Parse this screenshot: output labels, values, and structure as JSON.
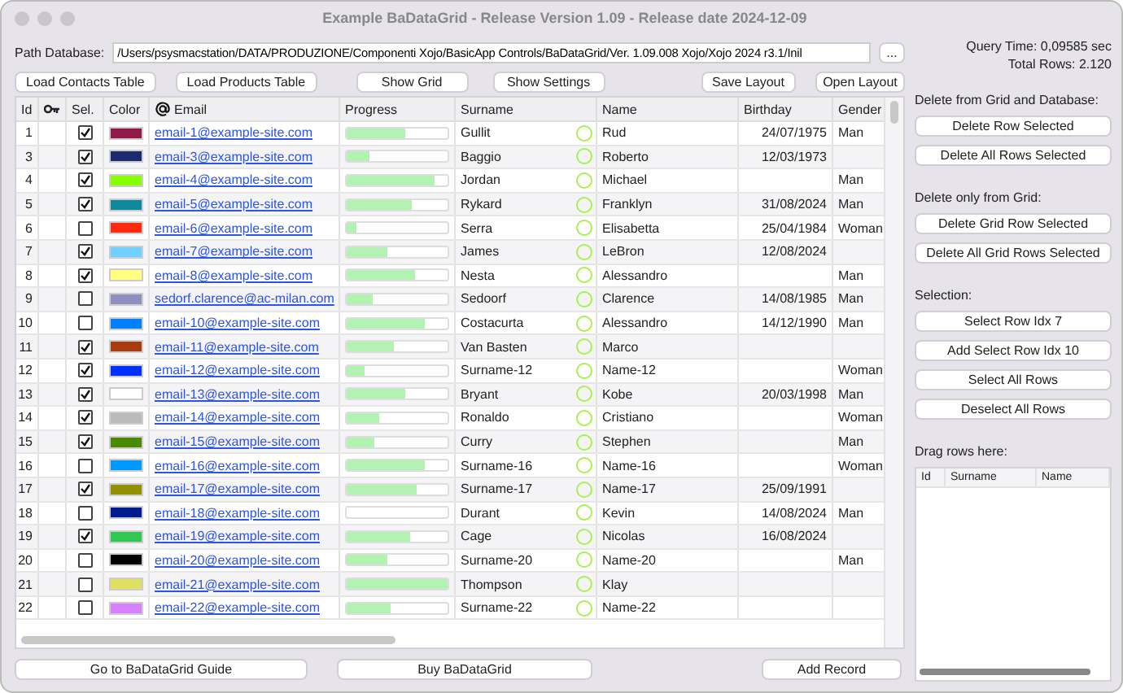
{
  "window": {
    "title": "Example BaDataGrid - Release Version 1.09 - Release date 2024-12-09"
  },
  "path": {
    "label": "Path Database:",
    "value": "/Users/psysmacstation/DATA/PRODUZIONE/Componenti Xojo/BasicApp Controls/BaDataGrid/Ver. 1.09.008 Xojo/Xojo 2024 r3.1/Inil",
    "browse": "..."
  },
  "query_time": "Query Time: 0,09585 sec",
  "total_rows": "Total Rows: 2.120",
  "toolbar": [
    "Load Contacts Table",
    "Load Products Table",
    "Show Grid",
    "Show Settings",
    "Save Layout",
    "Open Layout"
  ],
  "table": {
    "columns": [
      "Id",
      "",
      "Sel.",
      "Color",
      "Email",
      "Progress",
      "Surname",
      "Name",
      "Birthday",
      "Gender"
    ],
    "rows": [
      {
        "id": "1",
        "checked": true,
        "color": "#8f1a4a",
        "email": "email-1@example-site.com",
        "level": 0.58,
        "surname": "Gullit",
        "name": "Rud",
        "birthday": "24/07/1975",
        "gender": "Man"
      },
      {
        "id": "3",
        "checked": true,
        "color": "#1c2a6e",
        "email": "email-3@example-site.com",
        "level": 0.22,
        "surname": "Baggio",
        "name": "Roberto",
        "birthday": "12/03/1973",
        "gender": ""
      },
      {
        "id": "4",
        "checked": true,
        "color": "#88ff00",
        "email": "email-4@example-site.com",
        "level": 0.87,
        "surname": "Jordan",
        "name": "Michael",
        "birthday": "",
        "gender": "Man"
      },
      {
        "id": "5",
        "checked": true,
        "color": "#10889f",
        "email": "email-5@example-site.com",
        "level": 0.64,
        "surname": "Rykard",
        "name": "Franklyn",
        "birthday": "31/08/2024",
        "gender": "Man"
      },
      {
        "id": "6",
        "checked": false,
        "color": "#ff2a10",
        "email": "email-6@example-site.com",
        "level": 0.09,
        "surname": "Serra",
        "name": "Elisabetta",
        "birthday": "25/04/1984",
        "gender": "Woman"
      },
      {
        "id": "7",
        "checked": true,
        "color": "#70d0ff",
        "email": "email-7@example-site.com",
        "level": 0.4,
        "surname": "James",
        "name": "LeBron",
        "birthday": "12/08/2024",
        "gender": ""
      },
      {
        "id": "8",
        "checked": true,
        "color": "#ffff80",
        "email": "email-8@example-site.com",
        "level": 0.68,
        "surname": "Nesta",
        "name": "Alessandro",
        "birthday": "",
        "gender": "Man"
      },
      {
        "id": "9",
        "checked": false,
        "color": "#9090c0",
        "email": "sedorf.clarence@ac-milan.com",
        "level": 0.25,
        "surname": "Sedoorf",
        "name": "Clarence",
        "birthday": "14/08/1985",
        "gender": "Man"
      },
      {
        "id": "10",
        "checked": false,
        "color": "#0080ff",
        "email": "email-10@example-site.com",
        "level": 0.77,
        "surname": "Costacurta",
        "name": "Alessandro",
        "birthday": "14/12/1990",
        "gender": "Man"
      },
      {
        "id": "11",
        "checked": true,
        "color": "#a83c10",
        "email": "email-11@example-site.com",
        "level": 0.47,
        "surname": "Van Basten",
        "name": "Marco",
        "birthday": "",
        "gender": ""
      },
      {
        "id": "12",
        "checked": true,
        "color": "#0030ff",
        "email": "email-12@example-site.com",
        "level": 0.17,
        "surname": "Surname-12",
        "name": "Name-12",
        "birthday": "",
        "gender": "Woman"
      },
      {
        "id": "13",
        "checked": true,
        "color": "#ffffff",
        "email": "email-13@example-site.com",
        "level": 0.58,
        "surname": "Bryant",
        "name": "Kobe",
        "birthday": "20/03/1998",
        "gender": "Man"
      },
      {
        "id": "14",
        "checked": true,
        "color": "#bbbbbb",
        "email": "email-14@example-site.com",
        "level": 0.33,
        "surname": "Ronaldo",
        "name": "Cristiano",
        "birthday": "",
        "gender": "Woman"
      },
      {
        "id": "15",
        "checked": true,
        "color": "#4a8a00",
        "email": "email-15@example-site.com",
        "level": 0.27,
        "surname": "Curry",
        "name": "Stephen",
        "birthday": "",
        "gender": "Man"
      },
      {
        "id": "16",
        "checked": false,
        "color": "#0099ff",
        "email": "email-16@example-site.com",
        "level": 0.78,
        "surname": "Surname-16",
        "name": "Name-16",
        "birthday": "",
        "gender": "Woman"
      },
      {
        "id": "17",
        "checked": true,
        "color": "#909000",
        "email": "email-17@example-site.com",
        "level": 0.69,
        "surname": "Surname-17",
        "name": "Name-17",
        "birthday": "25/09/1991",
        "gender": ""
      },
      {
        "id": "18",
        "checked": false,
        "color": "#001a90",
        "email": "email-18@example-site.com",
        "surname": "Durant",
        "name": "Kevin",
        "birthday": "14/08/2024",
        "gender": "Man"
      },
      {
        "id": "19",
        "checked": true,
        "color": "#30c850",
        "email": "email-19@example-site.com",
        "level": 0.63,
        "surname": "Cage",
        "name": "Nicolas",
        "birthday": "16/08/2024",
        "gender": ""
      },
      {
        "id": "20",
        "checked": false,
        "color": "#000000",
        "email": "email-20@example-site.com",
        "level": 0.4,
        "surname": "Surname-20",
        "name": "Name-20",
        "birthday": "",
        "gender": "Man"
      },
      {
        "id": "21",
        "checked": false,
        "color": "#e0e060",
        "email": "email-21@example-site.com",
        "level": 1,
        "surname": "Thompson",
        "name": "Klay",
        "birthday": "",
        "gender": ""
      },
      {
        "id": "22",
        "checked": false,
        "color": "#d880ff",
        "email": "email-22@example-site.com",
        "level": 0.44,
        "surname": "Surname-22",
        "name": "Name-22",
        "birthday": "",
        "gender": ""
      }
    ]
  },
  "side": {
    "sections": [
      {
        "title": "Delete from Grid and Database:",
        "buttons": [
          "Delete Row Selected",
          "Delete All Rows Selected"
        ]
      },
      {
        "title": "Delete only from Grid:",
        "buttons": [
          "Delete Grid Row Selected",
          "Delete All Grid Rows Selected"
        ]
      },
      {
        "title": "Selection:",
        "buttons": [
          "Select Row Idx 7",
          "Add Select Row Idx 10",
          "Select All Rows",
          "Deselect All Rows"
        ]
      }
    ],
    "drag": {
      "title": "Drag rows here:",
      "columns": [
        "Id",
        "Surname",
        "Name"
      ]
    }
  },
  "footer": [
    "Go to BaDataGrid Guide",
    "Buy BaDataGrid",
    "Add Record"
  ]
}
